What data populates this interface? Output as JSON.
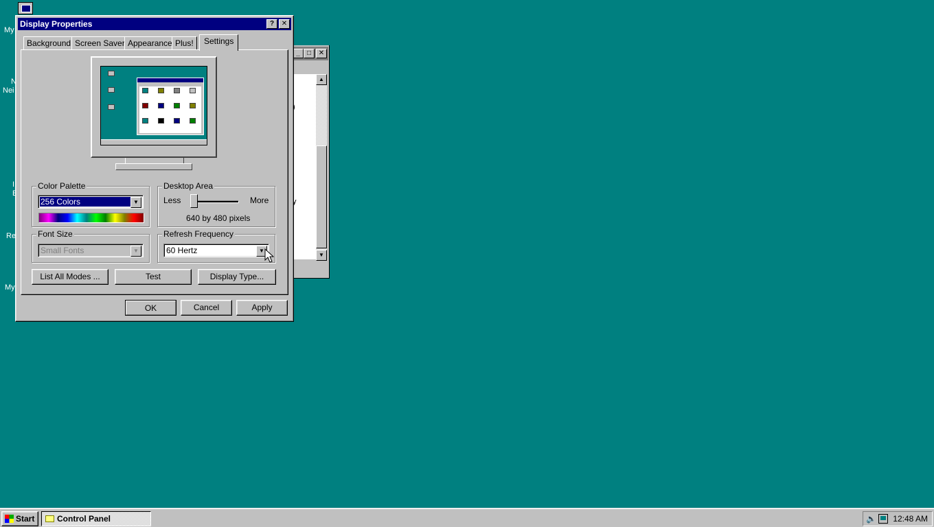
{
  "desktop": {
    "labels": [
      "My",
      "N",
      "Nei",
      "I",
      "E",
      "Re",
      "My"
    ]
  },
  "background_window": {
    "fragments": [
      ")",
      "y"
    ]
  },
  "dialog": {
    "title": "Display Properties",
    "help_button": "?",
    "close_button": "✕",
    "tabs": [
      {
        "label": "Background"
      },
      {
        "label": "Screen Saver"
      },
      {
        "label": "Appearance"
      },
      {
        "label": "Plus!"
      },
      {
        "label": "Settings",
        "active": true
      }
    ],
    "color_palette": {
      "legend": "Color Palette",
      "selected": "256 Colors"
    },
    "desktop_area": {
      "legend": "Desktop Area",
      "less_label": "Less",
      "more_label": "More",
      "resolution": "640 by 480 pixels",
      "slider_level": 0
    },
    "font_size": {
      "legend": "Font Size",
      "selected": "Small Fonts",
      "disabled": true
    },
    "refresh_frequency": {
      "legend": "Refresh Frequency",
      "selected": "60 Hertz"
    },
    "buttons": {
      "list_all_modes": "List All Modes ...",
      "test": "Test",
      "display_type": "Display Type...",
      "ok": "OK",
      "cancel": "Cancel",
      "apply": "Apply"
    }
  },
  "taskbar": {
    "start_label": "Start",
    "tasks": [
      {
        "label": "Control Panel"
      }
    ],
    "clock": "12:48 AM"
  },
  "colors": {
    "desktop": "#008080",
    "titlebar_active": "#000080",
    "titlebar_inactive": "#808080",
    "face": "#c0c0c0"
  }
}
